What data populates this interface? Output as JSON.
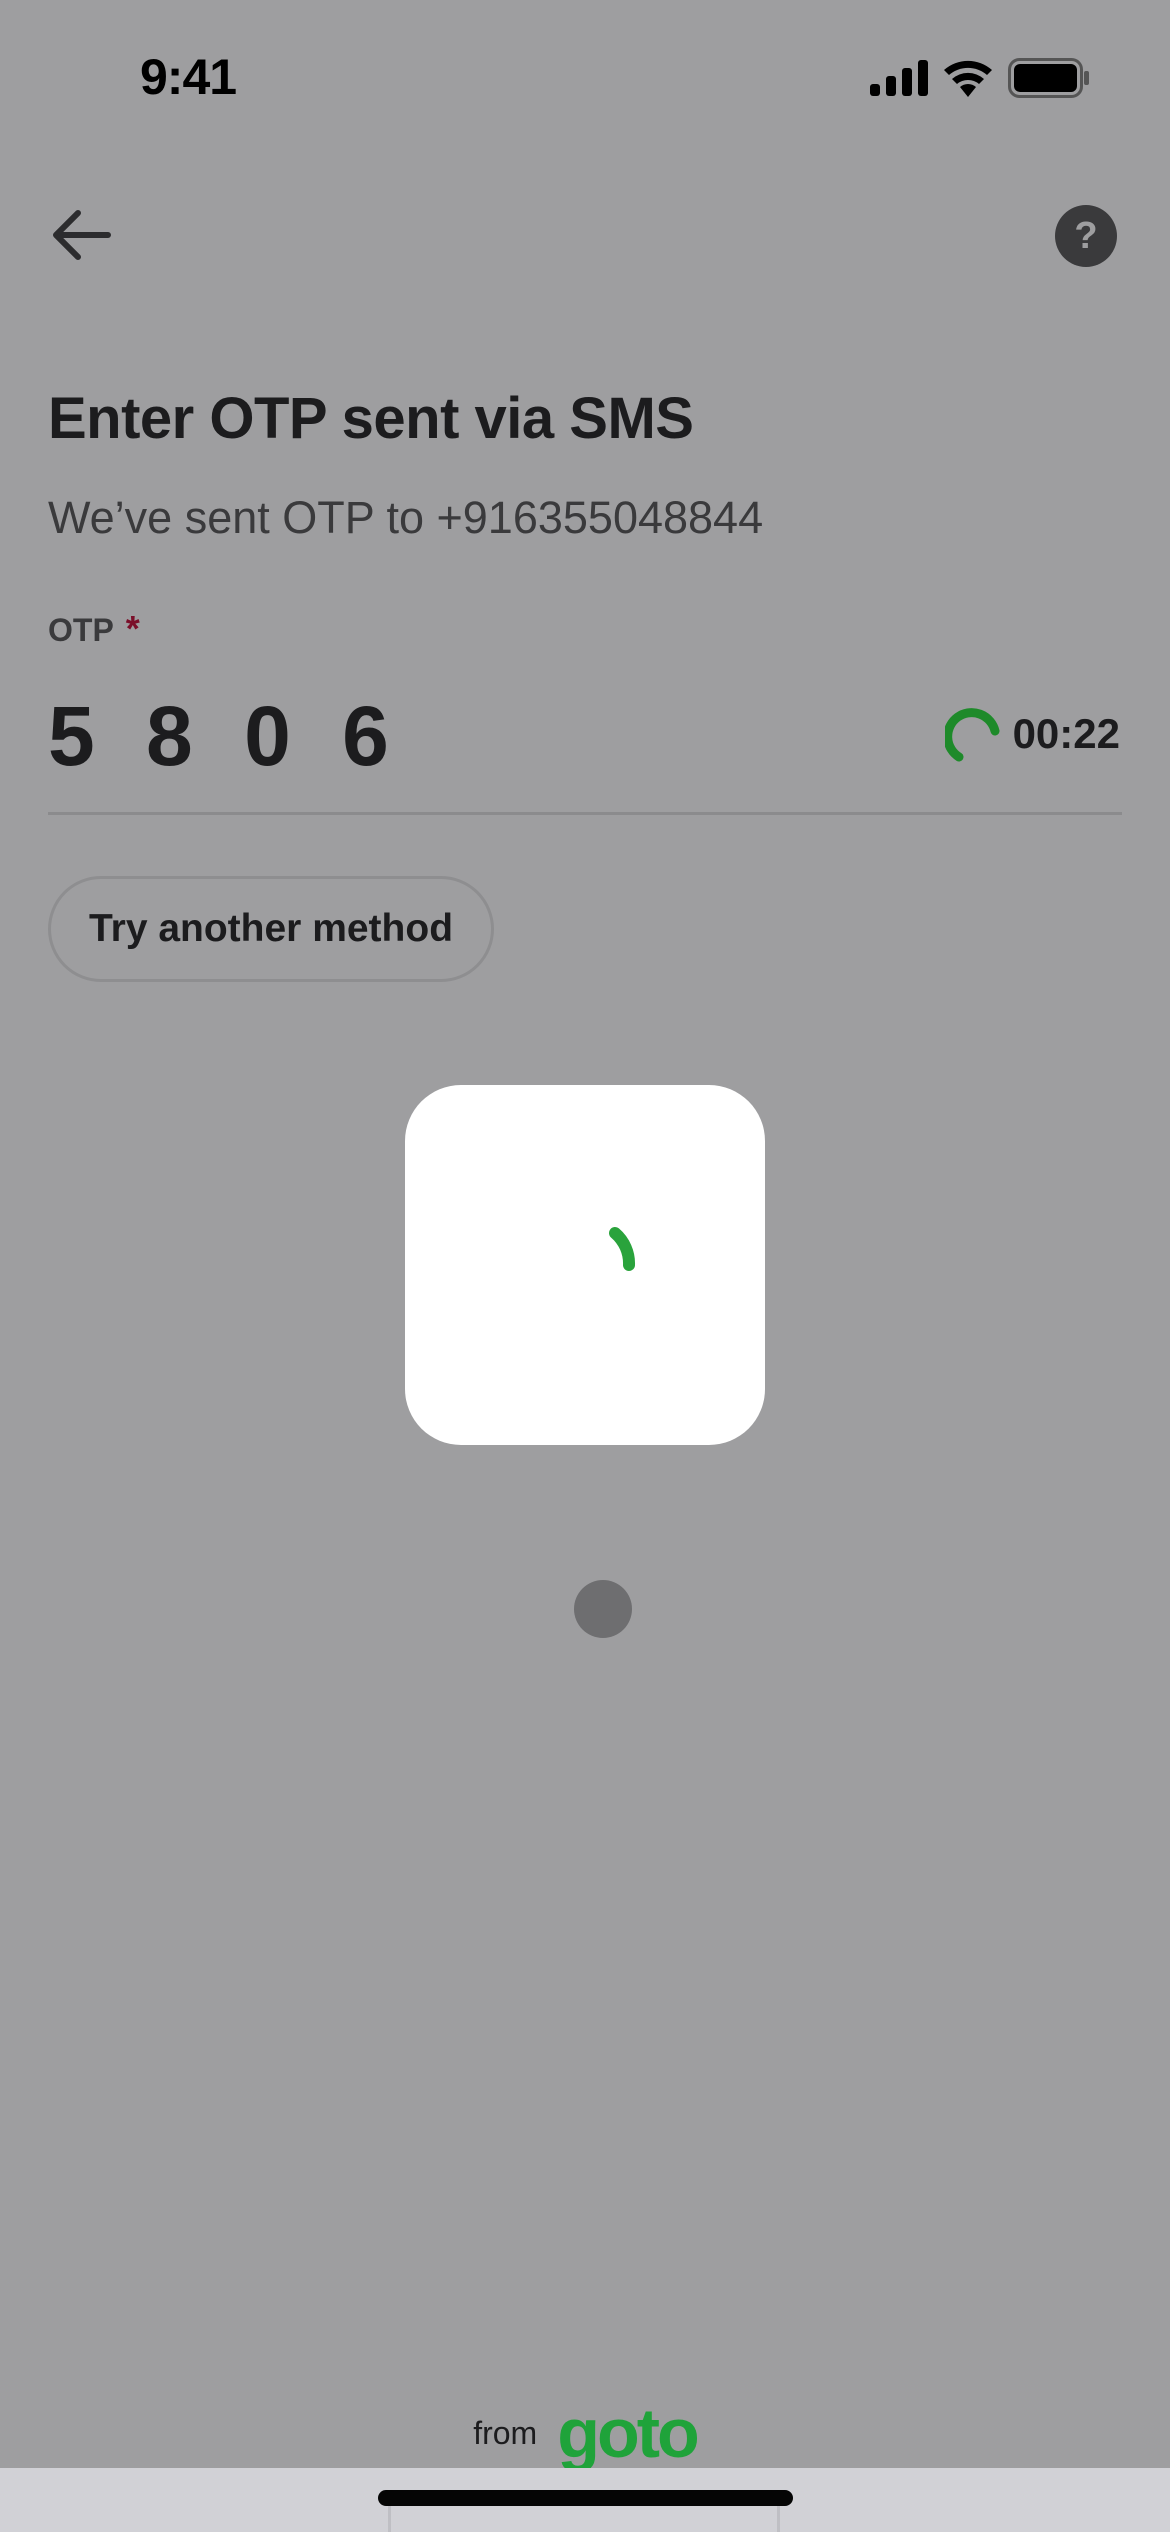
{
  "status_bar": {
    "time": "9:41",
    "icons": [
      "cellular-signal-icon",
      "wifi-icon",
      "battery-icon"
    ]
  },
  "nav": {
    "back_icon": "arrow-left-icon",
    "help_label": "?"
  },
  "header": {
    "title": "Enter OTP sent via SMS",
    "subtitle": "We’ve sent OTP to +916355048844"
  },
  "otp_field": {
    "label": "OTP",
    "required_marker": "*",
    "value": "5 8 0 6",
    "timer": "00:22"
  },
  "actions": {
    "try_another_method": "Try another method"
  },
  "loader": {
    "state": "loading"
  },
  "footer": {
    "from_label": "from",
    "brand": "goto"
  },
  "colors": {
    "brand_green": "#1fa33a",
    "timer_green": "#1e8a2a",
    "required_red": "#7b0f2a",
    "overlay_gray": "#9e9ea0"
  }
}
